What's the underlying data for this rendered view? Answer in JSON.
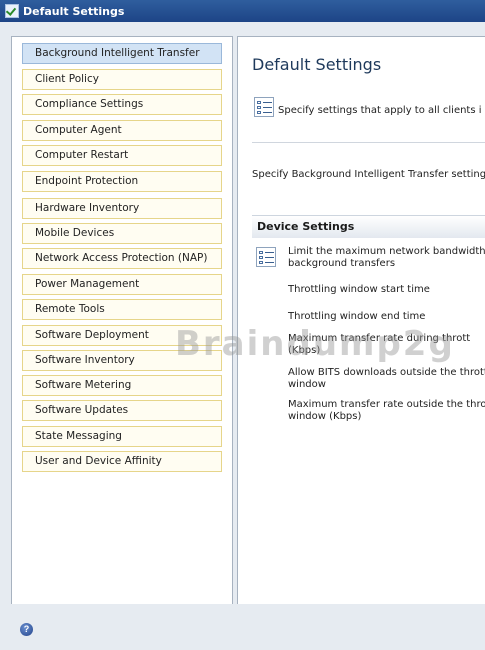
{
  "window": {
    "title": "Default Settings"
  },
  "nav": {
    "items": [
      {
        "label": "Background Intelligent Transfer",
        "selected": true
      },
      {
        "label": "Client Policy"
      },
      {
        "label": "Compliance Settings"
      },
      {
        "label": "Computer Agent"
      },
      {
        "label": "Computer Restart"
      },
      {
        "label": "Endpoint Protection"
      },
      {
        "label": "Hardware Inventory"
      },
      {
        "label": "Mobile Devices"
      },
      {
        "label": "Network Access Protection (NAP)"
      },
      {
        "label": "Power Management"
      },
      {
        "label": "Remote Tools"
      },
      {
        "label": "Software Deployment"
      },
      {
        "label": "Software Inventory"
      },
      {
        "label": "Software Metering"
      },
      {
        "label": "Software Updates"
      },
      {
        "label": "State Messaging"
      },
      {
        "label": "User and Device Affinity"
      }
    ]
  },
  "main": {
    "title": "Default Settings",
    "description": "Specify settings that apply to all clients i",
    "specify": "Specify Background Intelligent Transfer settings",
    "section_title": "Device Settings",
    "settings": {
      "limit_line1": "Limit the maximum network bandwidth fo",
      "limit_line2": "background transfers",
      "throttle_start": "Throttling window start time",
      "throttle_end": "Throttling window end time",
      "max_rate_line1": "Maximum transfer rate during thrott",
      "max_rate_line2": "(Kbps)",
      "allow_bits_line1": "Allow BITS downloads outside the thrott",
      "allow_bits_line2": "window",
      "max_outside_line1": "Maximum transfer rate outside the throttl",
      "max_outside_line2": "window (Kbps)"
    }
  },
  "watermark": "Braindump2g",
  "status": {
    "help_icon": "help-icon"
  }
}
